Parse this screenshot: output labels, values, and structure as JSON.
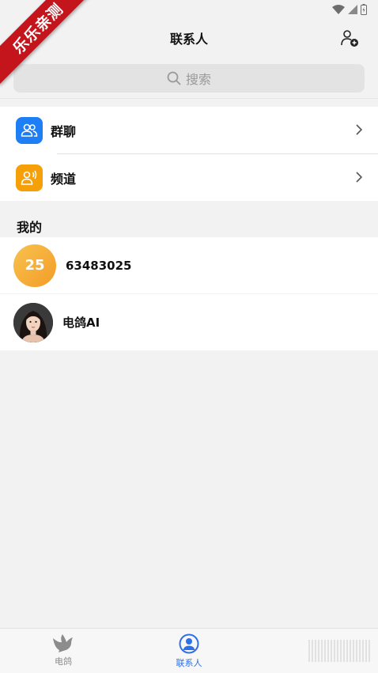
{
  "watermark": {
    "text": "乐乐亲测"
  },
  "header": {
    "title": "联系人"
  },
  "search": {
    "placeholder": "搜索"
  },
  "menu": [
    {
      "label": "群聊",
      "icon": "group-chat-icon",
      "color": "#1e7ef5"
    },
    {
      "label": "频道",
      "icon": "channel-icon",
      "color": "#f5a009"
    }
  ],
  "section": {
    "title": "我的"
  },
  "contacts": [
    {
      "avatar_text": "25",
      "name": "63483025"
    },
    {
      "avatar_text": "",
      "name": "电鸽AI"
    }
  ],
  "tabs": [
    {
      "label": "电鸽",
      "icon": "dove-icon",
      "active": false
    },
    {
      "label": "联系人",
      "icon": "contacts-icon",
      "active": true
    }
  ],
  "colors": {
    "accent": "#2f6fe8",
    "group_icon_bg": "#1e7ef5",
    "channel_icon_bg": "#f5a009",
    "watermark_bg": "#c4141c"
  }
}
